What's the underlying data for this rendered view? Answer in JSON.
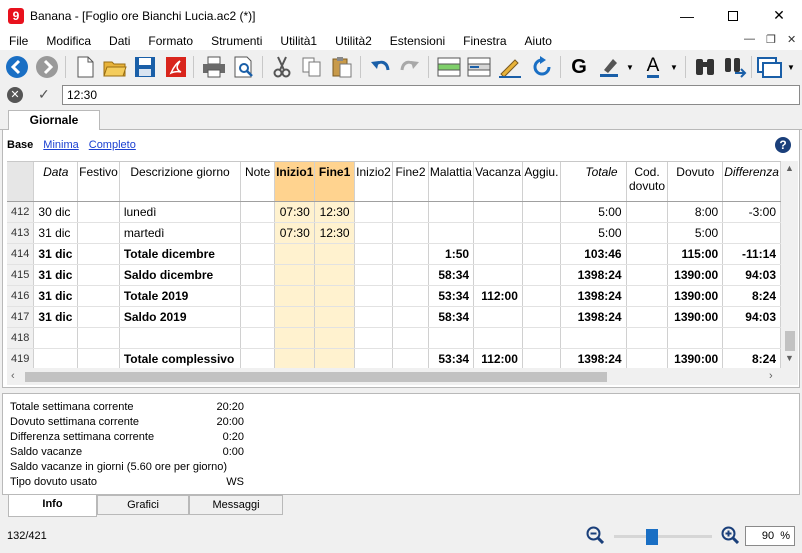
{
  "window": {
    "title": "Banana - [Foglio ore Bianchi Lucia.ac2 (*)]",
    "app_icon_letter": "9"
  },
  "menu": [
    "File",
    "Modifica",
    "Dati",
    "Formato",
    "Strumenti",
    "Utilità1",
    "Utilità2",
    "Estensioni",
    "Finestra",
    "Aiuto"
  ],
  "toolbar": {
    "bold_label": "G",
    "font_color_label": "A",
    "icons": [
      "back-icon",
      "forward-icon",
      "new-file-icon",
      "open-folder-icon",
      "save-icon",
      "pdf-icon",
      "print-icon",
      "print-preview-icon",
      "cut-icon",
      "copy-icon",
      "paste-icon",
      "undo-icon",
      "redo-icon",
      "insert-rows-icon",
      "delete-rows-icon",
      "edit-icon",
      "refresh-icon",
      "bold-icon",
      "highlight-icon",
      "font-color-icon",
      "find-icon",
      "find-next-icon",
      "window-switch-icon"
    ]
  },
  "formula_bar": {
    "value": "12:30"
  },
  "doc_tab": "Giornale",
  "views": {
    "active": "Base",
    "links": [
      "Minima",
      "Completo"
    ]
  },
  "table": {
    "headers": [
      "Data",
      "Festivo",
      "Descrizione giorno",
      "Note",
      "Inizio1",
      "Fine1",
      "Inizio2",
      "Fine2",
      "Malattia",
      "Vacanza",
      "Aggiu.",
      "Totale",
      "Cod. dovuto",
      "Dovuto",
      "Differenza"
    ],
    "rows": [
      {
        "n": "412",
        "bold": false,
        "cells": [
          "30 dic",
          "",
          "lunedì",
          "",
          "07:30",
          "12:30",
          "",
          "",
          "",
          "",
          "",
          "5:00",
          "",
          "8:00",
          "-3:00"
        ]
      },
      {
        "n": "413",
        "bold": false,
        "cells": [
          "31 dic",
          "",
          "martedì",
          "",
          "07:30",
          "12:30",
          "",
          "",
          "",
          "",
          "",
          "5:00",
          "",
          "5:00",
          ""
        ]
      },
      {
        "n": "414",
        "bold": true,
        "cells": [
          "31 dic",
          "",
          "Totale dicembre",
          "",
          "",
          "",
          "",
          "",
          "1:50",
          "",
          "",
          "103:46",
          "",
          "115:00",
          "-11:14"
        ]
      },
      {
        "n": "415",
        "bold": true,
        "cells": [
          "31 dic",
          "",
          "Saldo dicembre",
          "",
          "",
          "",
          "",
          "",
          "58:34",
          "",
          "",
          "1398:24",
          "",
          "1390:00",
          "94:03"
        ]
      },
      {
        "n": "416",
        "bold": true,
        "cells": [
          "31 dic",
          "",
          "Totale 2019",
          "",
          "",
          "",
          "",
          "",
          "53:34",
          "112:00",
          "",
          "1398:24",
          "",
          "1390:00",
          "8:24"
        ]
      },
      {
        "n": "417",
        "bold": true,
        "cells": [
          "31 dic",
          "",
          "Saldo 2019",
          "",
          "",
          "",
          "",
          "",
          "58:34",
          "",
          "",
          "1398:24",
          "",
          "1390:00",
          "94:03"
        ]
      },
      {
        "n": "418",
        "bold": false,
        "cells": [
          "",
          "",
          "",
          "",
          "",
          "",
          "",
          "",
          "",
          "",
          "",
          "",
          "",
          "",
          ""
        ]
      },
      {
        "n": "419",
        "bold": true,
        "cells": [
          "",
          "",
          "Totale complessivo",
          "",
          "",
          "",
          "",
          "",
          "53:34",
          "112:00",
          "",
          "1398:24",
          "",
          "1390:00",
          "8:24"
        ]
      }
    ]
  },
  "info": [
    {
      "label": "Totale settimana corrente",
      "value": "20:20"
    },
    {
      "label": "Dovuto settimana corrente",
      "value": "20:00"
    },
    {
      "label": "Differenza settimana corrente",
      "value": "0:20"
    },
    {
      "label": "Saldo vacanze",
      "value": "0:00"
    },
    {
      "label": "Saldo vacanze in giorni (5.60 ore per giorno)",
      "value": ""
    },
    {
      "label": "Tipo dovuto usato",
      "value": "WS"
    }
  ],
  "bottom_tabs": [
    "Info",
    "Grafici",
    "Messaggi"
  ],
  "status": {
    "position": "132/421",
    "zoom": "90",
    "zoom_unit": "%",
    "zoom_level_percent": 90
  }
}
